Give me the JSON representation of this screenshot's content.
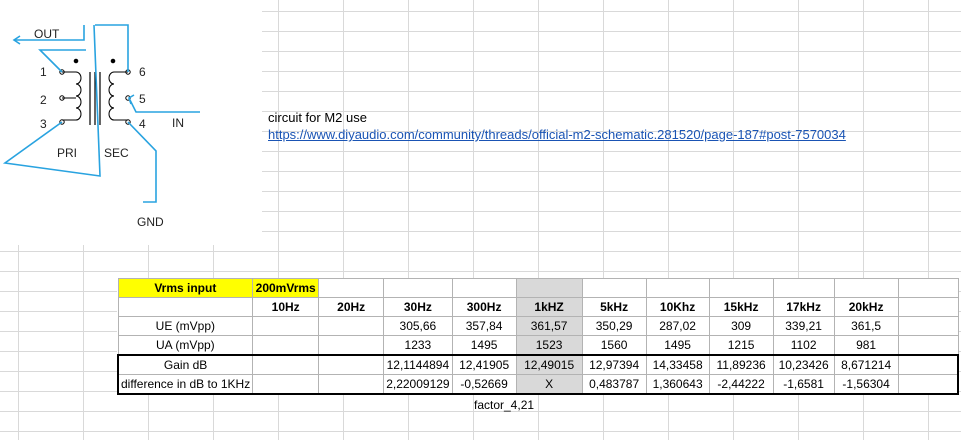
{
  "schematic": {
    "out_label": "OUT",
    "in_label": "IN",
    "gnd_label": "GND",
    "pri_label": "PRI",
    "sec_label": "SEC",
    "pins": [
      "1",
      "2",
      "3",
      "4",
      "5",
      "6"
    ],
    "line_color": "#29a3e0"
  },
  "note": {
    "title": "circuit for M2 use",
    "link": "https://www.diyaudio.com/community/threads/official-m2-schematic.281520/page-187#post-7570034"
  },
  "table": {
    "input_label": "Vrms input",
    "input_value": "200mVrms",
    "headers": [
      "10Hz",
      "20Hz",
      "30Hz",
      "300Hz",
      "1kHZ",
      "5kHz",
      "10Khz",
      "15kHz",
      "17kHz",
      "20kHz"
    ],
    "rows": [
      {
        "label": "UE (mVpp)",
        "cells": [
          "",
          "",
          "305,66",
          "357,84",
          "361,57",
          "350,29",
          "287,02",
          "309",
          "339,21",
          "361,5"
        ]
      },
      {
        "label": "UA  (mVpp)",
        "cells": [
          "",
          "",
          "1233",
          "1495",
          "1523",
          "1560",
          "1495",
          "1215",
          "1102",
          "981"
        ]
      },
      {
        "label": "Gain dB",
        "cells": [
          "",
          "",
          "12,1144894",
          "12,41905",
          "12,49015",
          "12,97394",
          "14,33458",
          "11,89236",
          "10,23426",
          "8,671214"
        ]
      },
      {
        "label": "difference in dB to 1KHz",
        "cells": [
          "",
          "",
          "2,22009129",
          "-0,52669",
          "X",
          "0,483787",
          "1,360643",
          "-2,44222",
          "-1,6581",
          "-1,56304"
        ]
      }
    ],
    "factor": "factor_4,21",
    "highlight_color": "#d9d9d9",
    "label_color": "#ffff00"
  }
}
